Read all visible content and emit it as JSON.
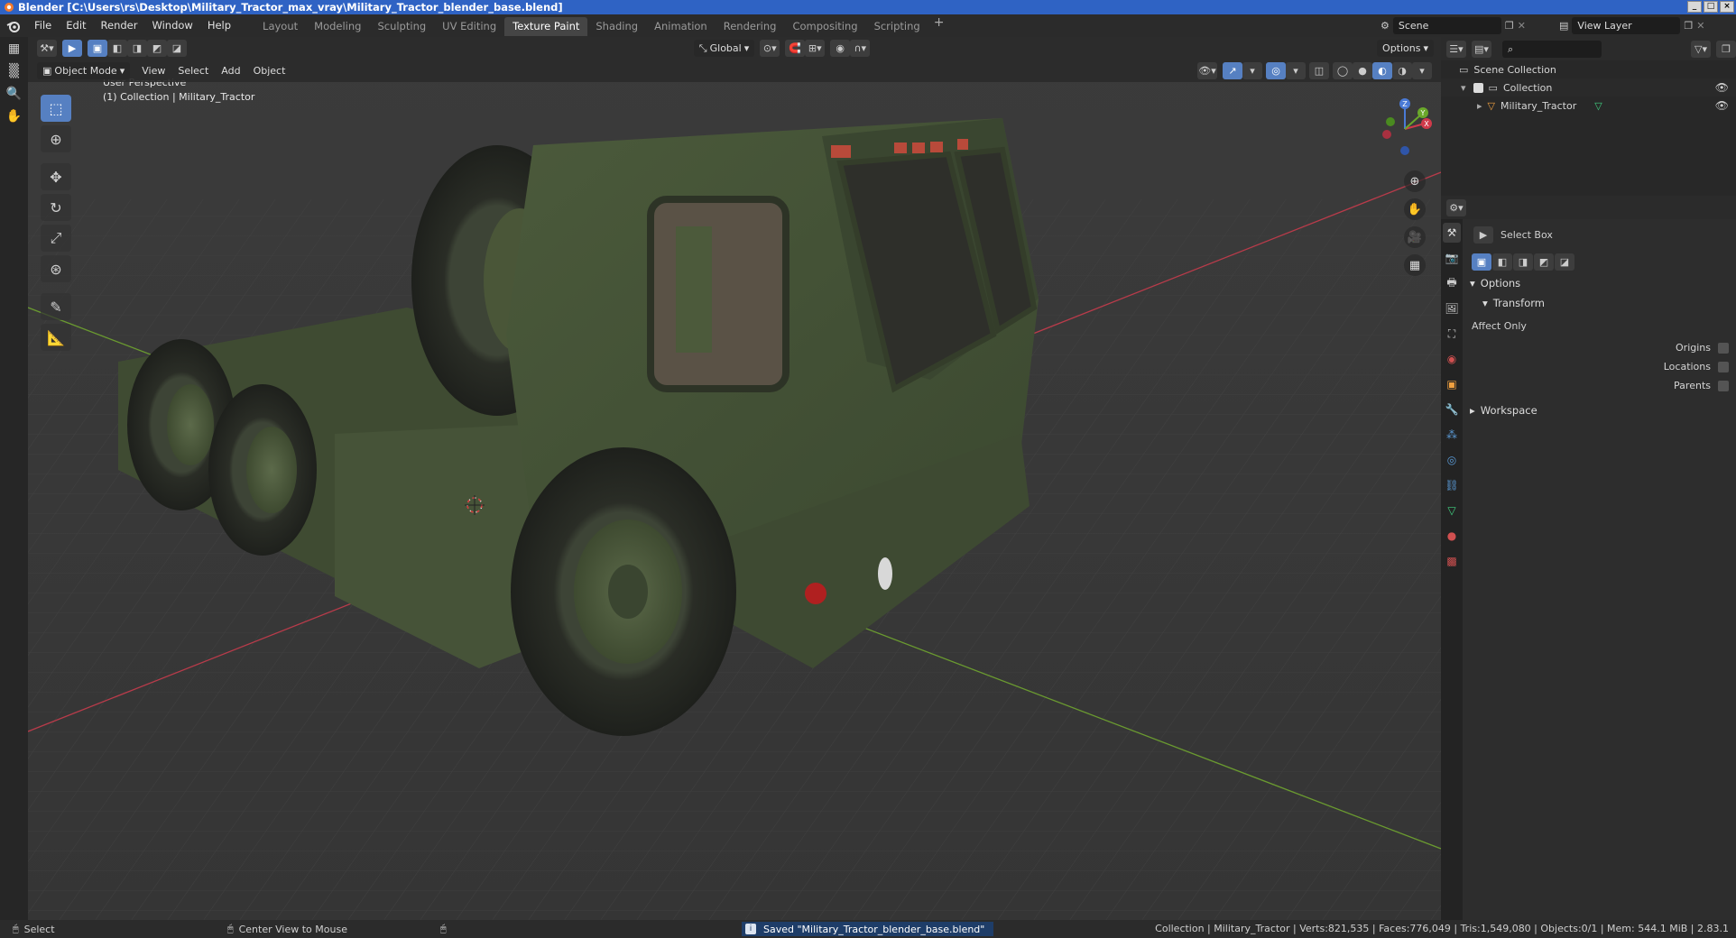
{
  "window": {
    "title": "Blender [C:\\Users\\rs\\Desktop\\Military_Tractor_max_vray\\Military_Tractor_blender_base.blend]",
    "controls": [
      "_",
      "□",
      "×"
    ]
  },
  "menu": [
    "File",
    "Edit",
    "Render",
    "Window",
    "Help"
  ],
  "workspaces": {
    "tabs": [
      "Layout",
      "Modeling",
      "Sculpting",
      "UV Editing",
      "Texture Paint",
      "Shading",
      "Animation",
      "Rendering",
      "Compositing",
      "Scripting"
    ],
    "active": "Texture Paint",
    "add": "+"
  },
  "scene": {
    "name": "Scene"
  },
  "view_layer": {
    "name": "View Layer"
  },
  "viewport": {
    "transform_orientation": "Global",
    "options_label": "Options",
    "mode": "Object Mode",
    "menus": [
      "View",
      "Select",
      "Add",
      "Object"
    ],
    "overlay_title": "User Perspective",
    "overlay_subtitle": "(1) Collection | Military_Tractor",
    "gizmo_axes": [
      "X",
      "Y",
      "Z"
    ]
  },
  "outliner": {
    "root": "Scene Collection",
    "collection": "Collection",
    "object": "Military_Tractor"
  },
  "properties": {
    "tool_name": "Select Box",
    "options_panel": "Options",
    "transform_panel": "Transform",
    "affect_only": "Affect Only",
    "origins": "Origins",
    "locations": "Locations",
    "parents": "Parents",
    "workspace_panel": "Workspace"
  },
  "status": {
    "left_action": "Select",
    "middle_action": "Center View to Mouse",
    "message": "Saved \"Military_Tractor_blender_base.blend\"",
    "stats": "Collection | Military_Tractor | Verts:821,535 | Faces:776,049 | Tris:1,549,080 | Objects:0/1 | Mem: 544.1 MiB | 2.83.1"
  },
  "colors": {
    "accent": "#5680c2",
    "titlebar": "#2f63c4",
    "viewport_bg": "#393939",
    "truck_green": "#4a5a3a",
    "x_axis": "#d23c4b",
    "y_axis": "#7ab83a"
  }
}
